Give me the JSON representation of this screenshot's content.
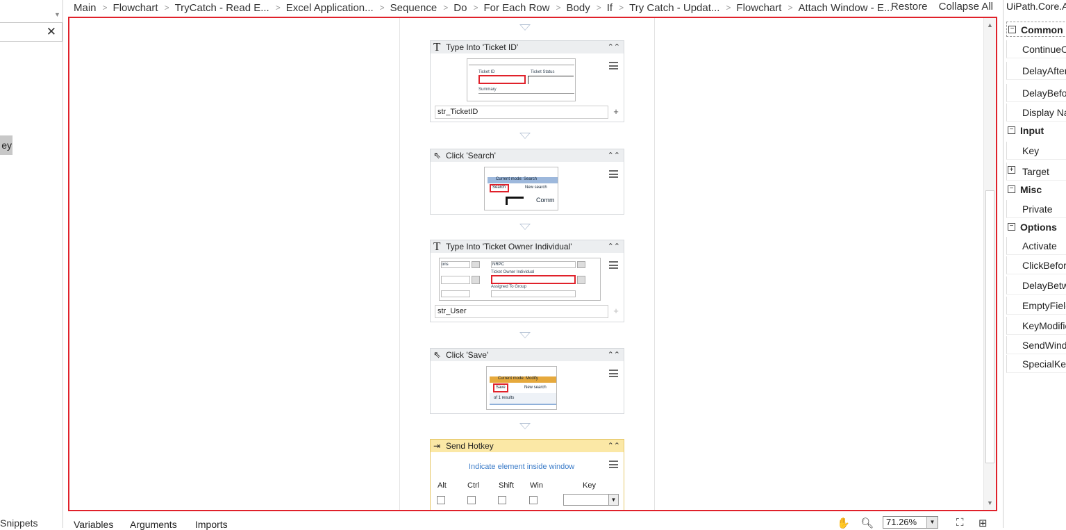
{
  "left_panel": {
    "selected_item_text": "ey",
    "snippets_label": "Snippets"
  },
  "breadcrumb": {
    "items": [
      "Main",
      "Flowchart",
      "TryCatch - Read E...",
      "Excel Application...",
      "Sequence",
      "Do",
      "For Each Row",
      "Body",
      "If",
      "Try Catch - Updat...",
      "Flowchart",
      "Attach Window - E..."
    ],
    "restore_label": "Restore",
    "collapse_all_label": "Collapse All"
  },
  "activities": {
    "type_ticket_id": {
      "title": "Type Into 'Ticket ID'",
      "shot_labels": {
        "field1": "Ticket ID",
        "field2": "Ticket Status",
        "field3": "Summary"
      },
      "value": "str_TicketID"
    },
    "click_search": {
      "title": "Click 'Search'",
      "shot_labels": {
        "mode": "Current mode: Search",
        "btn": "Search",
        "new": "New search",
        "extra": "Comm"
      }
    },
    "type_ticket_owner": {
      "title": "Type Into 'Ticket Owner Individual'",
      "shot_labels": {
        "left": "ons",
        "nrpc": "NRPC",
        "owner": "Ticket Owner Individual",
        "group": "Assigned To Group"
      },
      "value": "str_User"
    },
    "click_save": {
      "title": "Click 'Save'",
      "shot_labels": {
        "mode": "Current mode: Modify",
        "btn": "Save",
        "new": "New search",
        "results": "of 1 results"
      }
    },
    "send_hotkey": {
      "title": "Send Hotkey",
      "indicate_link": "Indicate element inside window",
      "alt": "Alt",
      "ctrl": "Ctrl",
      "shift": "Shift",
      "win": "Win",
      "key": "Key"
    }
  },
  "bottom_bar": {
    "variables": "Variables",
    "arguments": "Arguments",
    "imports": "Imports",
    "zoom": "71.26%"
  },
  "properties": {
    "title": "UiPath.Core.Activities.SendHotkey",
    "categories": {
      "common": "Common",
      "input": "Input",
      "misc": "Misc",
      "options": "Options"
    },
    "common_rows": [
      "ContinueOnError",
      "DelayAfter",
      "DelayBefore",
      "Display Name"
    ],
    "input_rows": [
      "Key",
      "Target"
    ],
    "misc_rows": [
      "Private"
    ],
    "options_rows": [
      "Activate",
      "ClickBeforeTyping",
      "DelayBetweenKeys",
      "EmptyField",
      "KeyModifiers",
      "SendWindowMessages",
      "SpecialKey"
    ]
  },
  "colors": {
    "selection_border": "#e0212a",
    "hotkey_header": "#fbe8a6"
  }
}
